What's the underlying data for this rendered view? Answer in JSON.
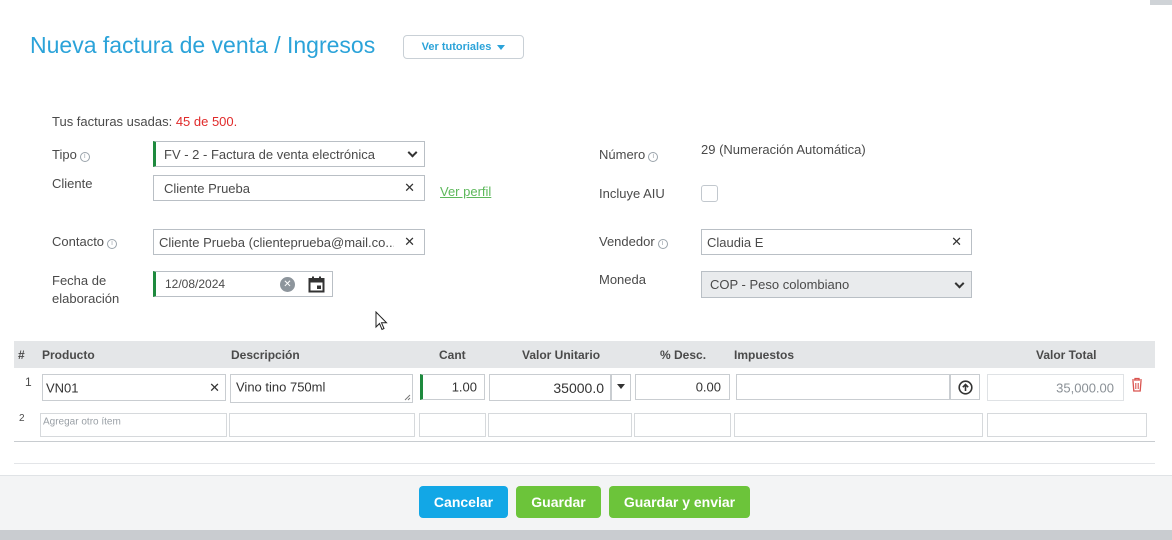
{
  "header": {
    "title": "Nueva factura de venta / Ingresos",
    "tutorials_label": "Ver tutoriales"
  },
  "usage": {
    "label": "Tus facturas usadas:",
    "value": "45 de 500."
  },
  "form": {
    "tipo": {
      "label": "Tipo",
      "value": "FV - 2 - Factura de venta electrónica"
    },
    "cliente": {
      "label": "Cliente",
      "value": "Cliente Prueba",
      "link": "Ver perfil"
    },
    "contacto": {
      "label": "Contacto",
      "value": "Cliente Prueba (clienteprueba@mail.co..."
    },
    "fecha": {
      "label_line1": "Fecha de",
      "label_line2": "elaboración",
      "value": "12/08/2024"
    },
    "numero": {
      "label": "Número",
      "value": "29 (Numeración Automática)"
    },
    "aiu": {
      "label": "Incluye AIU",
      "checked": false
    },
    "vendedor": {
      "label": "Vendedor",
      "value": "Claudia E"
    },
    "moneda": {
      "label": "Moneda",
      "value": "COP - Peso colombiano"
    }
  },
  "table": {
    "headers": {
      "num": "#",
      "producto": "Producto",
      "descripcion": "Descripción",
      "cant": "Cant",
      "valor_unitario": "Valor Unitario",
      "desc": "% Desc.",
      "impuestos": "Impuestos",
      "valor_total": "Valor Total"
    },
    "rows": [
      {
        "num": "1",
        "producto": "VN01",
        "descripcion": "Vino tino 750ml",
        "cant": "1.00",
        "valor_unitario": "35000.0",
        "desc": "0.00",
        "impuestos": "",
        "valor_total": "35,000.00"
      }
    ],
    "new_row": {
      "num": "2",
      "placeholder": "Agregar otro ítem"
    }
  },
  "footer": {
    "cancel_label": "Cancelar",
    "save_label": "Guardar",
    "save_send_label": "Guardar y enviar"
  },
  "colors": {
    "accent": "#2ba3d9",
    "required": "#1e8a3e",
    "cancel": "#12a7e6",
    "save": "#6cc43a",
    "warning": "#e02a2a"
  }
}
